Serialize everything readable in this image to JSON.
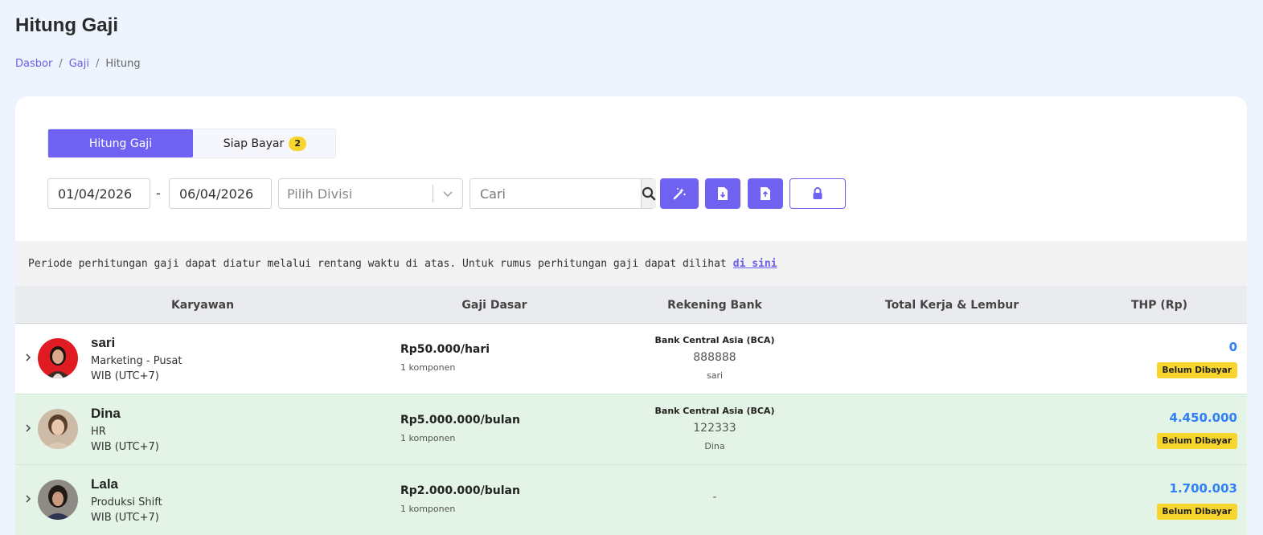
{
  "page": {
    "title": "Hitung Gaji",
    "breadcrumb": [
      "Dasbor",
      "Gaji",
      "Hitung"
    ]
  },
  "tabs": {
    "active_label": "Hitung Gaji",
    "inactive_label": "Siap Bayar",
    "inactive_count": "2"
  },
  "filters": {
    "start_date": "01/04/2026",
    "date_separator": "-",
    "end_date": "06/04/2026",
    "division_placeholder": "Pilih Divisi",
    "search_placeholder": "Cari"
  },
  "info": {
    "text": "Periode perhitungan gaji dapat diatur melalui rentang waktu di atas. Untuk rumus perhitungan gaji dapat dilihat",
    "link_text": "di sini"
  },
  "table": {
    "headers": [
      "Karyawan",
      "Gaji Dasar",
      "Rekening Bank",
      "Total Kerja & Lembur",
      "THP (Rp)"
    ],
    "rows": [
      {
        "name": "sari",
        "division": "Marketing - Pusat",
        "timezone": "WIB (UTC+7)",
        "salary": "Rp50.000/hari",
        "components": "1 komponen",
        "bank_name": "Bank Central Asia (BCA)",
        "bank_number": "888888",
        "bank_holder": "sari",
        "total_work": "",
        "thp": "0",
        "status": "Belum Dibayar"
      },
      {
        "name": "Dina",
        "division": "HR",
        "timezone": "WIB (UTC+7)",
        "salary": "Rp5.000.000/bulan",
        "components": "1 komponen",
        "bank_name": "Bank Central Asia (BCA)",
        "bank_number": "122333",
        "bank_holder": "Dina",
        "total_work": "",
        "thp": "4.450.000",
        "status": "Belum Dibayar"
      },
      {
        "name": "Lala",
        "division": "Produksi Shift",
        "timezone": "WIB (UTC+7)",
        "salary": "Rp2.000.000/bulan",
        "components": "1 komponen",
        "bank_dash": "-",
        "total_work": "",
        "thp": "1.700.003",
        "status": "Belum Dibayar"
      }
    ]
  },
  "colors": {
    "accent": "#6f62f0",
    "thp_blue": "#2f7ff7",
    "badge_yellow": "#f8d52c",
    "row_green": "#e3f3e5"
  },
  "icons": [
    "magic-wand-icon",
    "file-download-icon",
    "file-upload-icon",
    "lock-icon",
    "search-icon",
    "chevron-down-icon",
    "chevron-right-icon"
  ]
}
